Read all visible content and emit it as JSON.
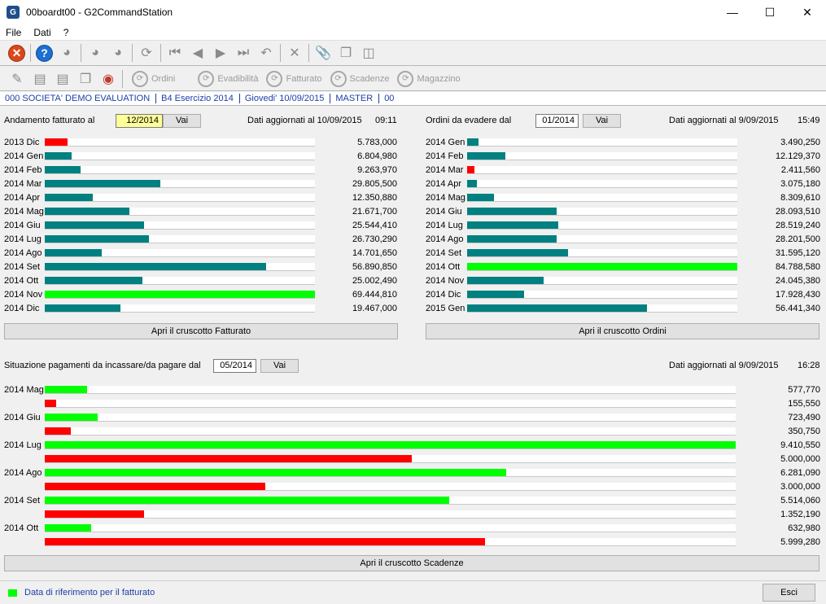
{
  "window": {
    "title": "00boardt00 - G2CommandStation",
    "app_icon_text": "G"
  },
  "menu": [
    "File",
    "Dati",
    "?"
  ],
  "toolbar2_buttons": [
    "Ordini",
    "Evadibilità",
    "Fatturato",
    "Scadenze",
    "Magazzino"
  ],
  "status": [
    "000 SOCIETA'  DEMO EVALUATION",
    "B4 Esercizio 2014",
    "Giovedi' 10/09/2015",
    "MASTER",
    "00"
  ],
  "colors": {
    "teal": "#008080",
    "red": "#ff0000",
    "green": "#00ff00"
  },
  "fatturato": {
    "label": "Andamento fatturato al",
    "period": "12/2014",
    "vai": "Vai",
    "updated_label": "Dati aggiornati al 10/09/2015",
    "updated_time": "09:11",
    "button": "Apri il cruscotto Fatturato",
    "chart_data": {
      "type": "bar",
      "orientation": "horizontal",
      "categories": [
        "2013 Dic",
        "2014 Gen",
        "2014 Feb",
        "2014 Mar",
        "2014 Apr",
        "2014 Mag",
        "2014 Giu",
        "2014 Lug",
        "2014 Ago",
        "2014 Set",
        "2014 Ott",
        "2014 Nov",
        "2014 Dic"
      ],
      "values": [
        5783000,
        6804980,
        9263970,
        29805500,
        12350880,
        21671700,
        25544410,
        26730290,
        14701650,
        56890850,
        25002490,
        69444810,
        19467000
      ],
      "value_labels": [
        "5.783,000",
        "6.804,980",
        "9.263,970",
        "29.805,500",
        "12.350,880",
        "21.671,700",
        "25.544,410",
        "26.730,290",
        "14.701,650",
        "56.890,850",
        "25.002,490",
        "69.444,810",
        "19.467,000"
      ],
      "colors": [
        "red",
        "teal",
        "teal",
        "teal",
        "teal",
        "teal",
        "teal",
        "teal",
        "teal",
        "teal",
        "teal",
        "green",
        "teal"
      ],
      "max": 69444810
    }
  },
  "ordini": {
    "label": "Ordini da evadere dal",
    "period": "01/2014",
    "vai": "Vai",
    "updated_label": "Dati aggiornati al  9/09/2015",
    "updated_time": "15:49",
    "button": "Apri il cruscotto Ordini",
    "chart_data": {
      "type": "bar",
      "orientation": "horizontal",
      "categories": [
        "2014 Gen",
        "2014 Feb",
        "2014 Mar",
        "2014 Apr",
        "2014 Mag",
        "2014 Giu",
        "2014 Lug",
        "2014 Ago",
        "2014 Set",
        "2014 Ott",
        "2014 Nov",
        "2014 Dic",
        "2015 Gen"
      ],
      "values": [
        3490250,
        12129370,
        2411560,
        3075180,
        8309610,
        28093510,
        28519240,
        28201500,
        31595120,
        84788580,
        24045380,
        17928430,
        56441340
      ],
      "value_labels": [
        "3.490,250",
        "12.129,370",
        "2.411,560",
        "3.075,180",
        "8.309,610",
        "28.093,510",
        "28.519,240",
        "28.201,500",
        "31.595,120",
        "84.788,580",
        "24.045,380",
        "17.928,430",
        "56.441,340"
      ],
      "colors": [
        "teal",
        "teal",
        "red",
        "teal",
        "teal",
        "teal",
        "teal",
        "teal",
        "teal",
        "green",
        "teal",
        "teal",
        "teal"
      ],
      "max": 84788580
    }
  },
  "pagamenti": {
    "label": "Situazione pagamenti da incassare/da pagare dal",
    "period": "05/2014",
    "vai": "Vai",
    "updated_label": "Dati aggiornati al  9/09/2015",
    "updated_time": "16:28",
    "button": "Apri il cruscotto Scadenze",
    "chart_data": {
      "type": "bar",
      "orientation": "horizontal",
      "categories": [
        "2014 Mag",
        "",
        "2014 Giu",
        "",
        "2014 Lug",
        "",
        "2014 Ago",
        "",
        "2014 Set",
        "",
        "2014 Ott",
        ""
      ],
      "values": [
        577770,
        155550,
        723490,
        350750,
        9410550,
        5000000,
        6281090,
        3000000,
        5514060,
        1352190,
        632980,
        5999280
      ],
      "value_labels": [
        "577,770",
        "155,550",
        "723,490",
        "350,750",
        "9.410,550",
        "5.000,000",
        "6.281,090",
        "3.000,000",
        "5.514,060",
        "1.352,190",
        "632,980",
        "5.999,280"
      ],
      "colors": [
        "green",
        "red",
        "green",
        "red",
        "green",
        "red",
        "green",
        "red",
        "green",
        "red",
        "green",
        "red"
      ],
      "max": 9410550
    }
  },
  "legend": "Data di riferimento per il fatturato",
  "exit_button": "Esci"
}
